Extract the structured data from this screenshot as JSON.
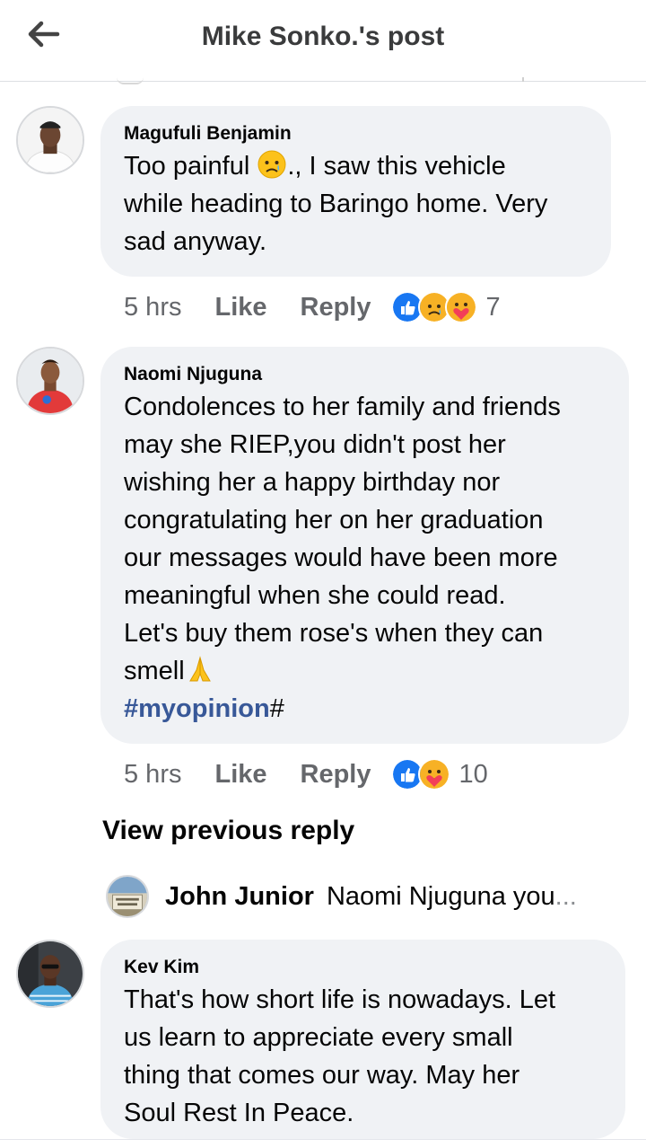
{
  "header": {
    "title": "Mike Sonko.'s post",
    "back_icon": "arrow-left-icon"
  },
  "comments": [
    {
      "author": "Magufuli Benjamin",
      "lines": [
        "Too painful",
        "., I saw this vehicle",
        "while heading to Baringo home. Very",
        "sad anyway."
      ],
      "inline_emoji": "crying-face-icon",
      "time": "5 hrs",
      "like_label": "Like",
      "reply_label": "Reply",
      "reactions": [
        "like-reaction-icon",
        "sad-reaction-icon",
        "care-reaction-icon"
      ],
      "reaction_count": "7"
    },
    {
      "author": "Naomi Njuguna",
      "lines": [
        "Condolences to her family and friends",
        "may she RIEP,you didn't post her",
        "wishing her a happy birthday nor",
        "congratulating her on her graduation",
        "our messages would have been more",
        "meaningful when she could read.",
        "Let's buy them rose's when they can",
        "smell"
      ],
      "hashtag": "#myopinion",
      "hashtag_suffix": "#",
      "inline_emoji": "folded-hands-icon",
      "time": "5 hrs",
      "like_label": "Like",
      "reply_label": "Reply",
      "reactions": [
        "like-reaction-icon",
        "care-reaction-icon"
      ],
      "reaction_count": "10"
    },
    {
      "author": "Kev Kim",
      "lines": [
        "That's how short life is nowadays. Let",
        "us learn to appreciate every small",
        "thing that comes our way. May her",
        "Soul Rest In Peace."
      ]
    }
  ],
  "view_previous": "View previous reply",
  "reply_preview": {
    "author": "John Junior",
    "snippet": "Naomi Njuguna you",
    "ellipsis": "..."
  },
  "colors": {
    "like_blue": "#1877f2",
    "hashtag": "#385898",
    "bubble": "#f0f2f5",
    "meta": "#65676b"
  }
}
